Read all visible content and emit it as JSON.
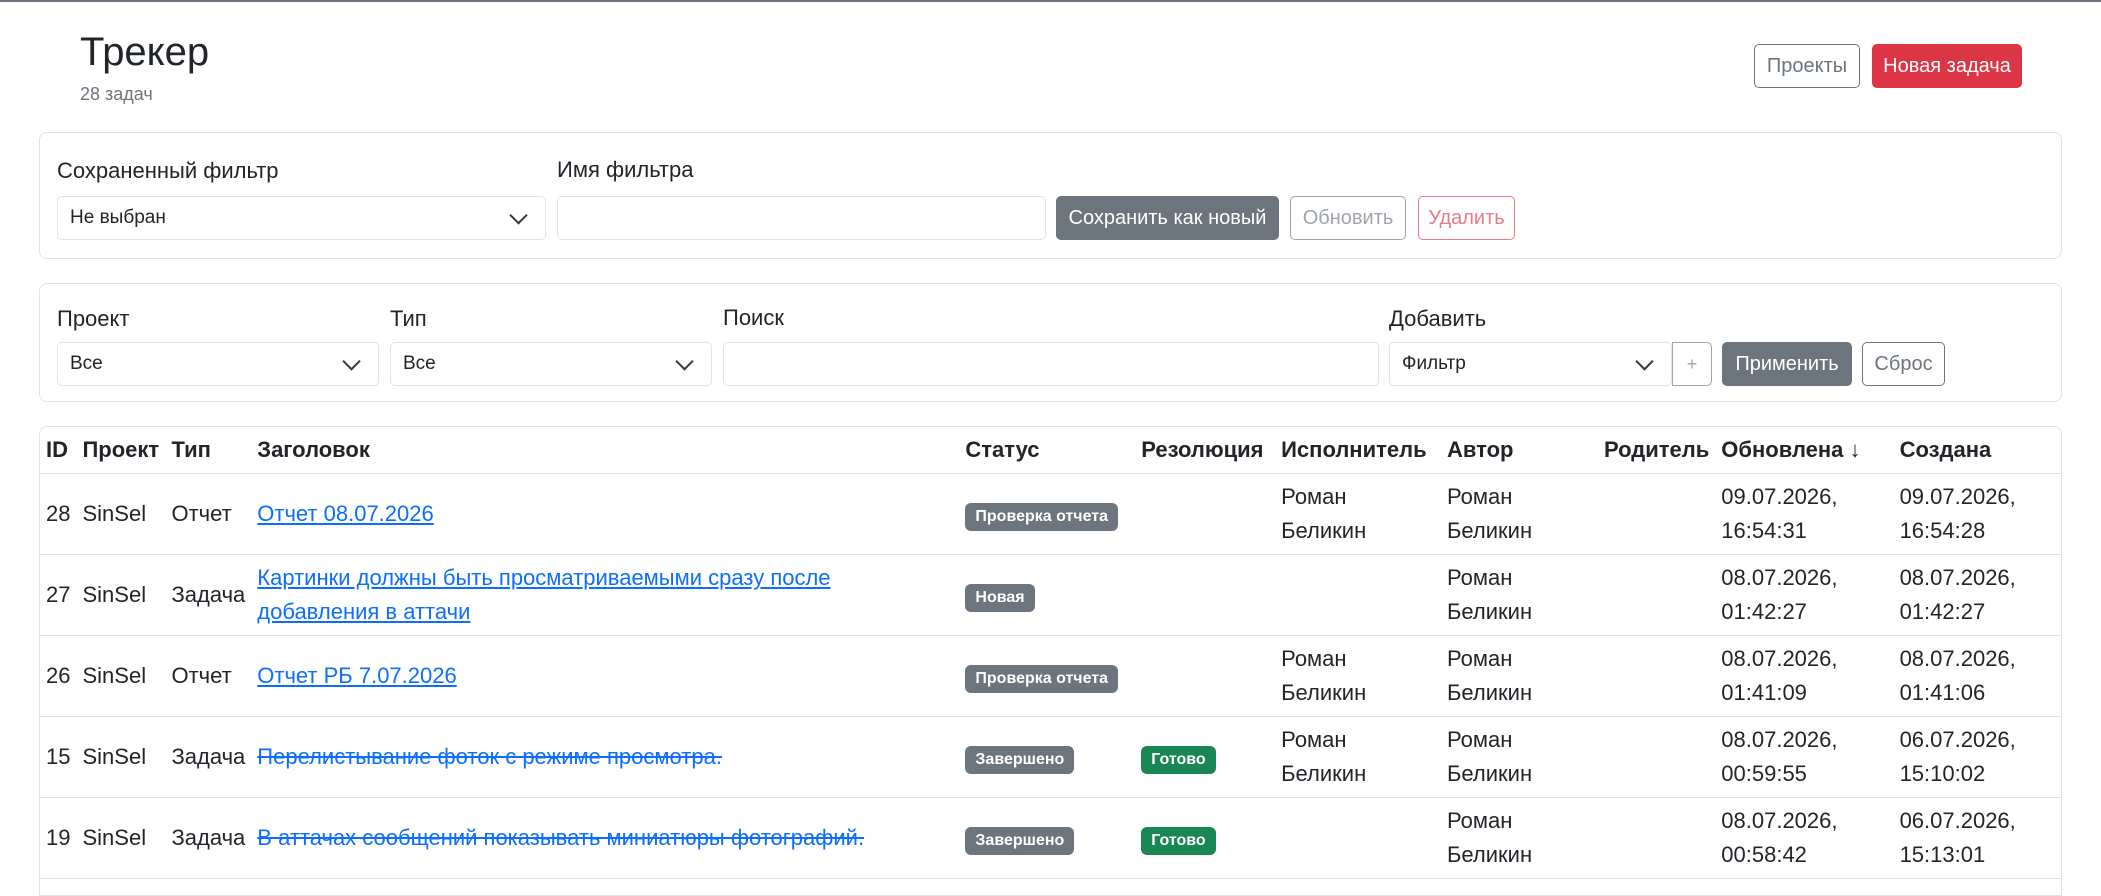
{
  "header": {
    "title": "Трекер",
    "count": "28 задач",
    "projects_button": "Проекты",
    "new_task_button": "Новая задача"
  },
  "saved_filter": {
    "label": "Сохраненный фильтр",
    "selected": "Не выбран",
    "name_label": "Имя фильтра",
    "name_value": "",
    "save_new_button": "Сохранить как новый",
    "update_button": "Обновить",
    "delete_button": "Удалить"
  },
  "filters": {
    "project_label": "Проект",
    "project_selected": "Все",
    "type_label": "Тип",
    "type_selected": "Все",
    "search_label": "Поиск",
    "search_value": "",
    "add_label": "Добавить",
    "add_selected": "Фильтр",
    "plus_button": "+",
    "apply_button": "Применить",
    "reset_button": "Сброс"
  },
  "table": {
    "columns": {
      "id": "ID",
      "project": "Проект",
      "type": "Тип",
      "title": "Заголовок",
      "status": "Статус",
      "resolution": "Резолюция",
      "assignee": "Исполнитель",
      "author": "Автор",
      "parent": "Родитель",
      "updated": "Обновлена ↓",
      "created": "Создана"
    },
    "rows": [
      {
        "id": "28",
        "project": "SinSel",
        "type": "Отчет",
        "title": "Отчет 08.07.2026",
        "status": "Проверка отчета",
        "resolution": "",
        "assignee_1": "Роман",
        "assignee_2": "Беликин",
        "author_1": "Роман",
        "author_2": "Беликин",
        "parent": "",
        "updated_1": "09.07.2026,",
        "updated_2": "16:54:31",
        "created_1": "09.07.2026,",
        "created_2": "16:54:28"
      },
      {
        "id": "27",
        "project": "SinSel",
        "type": "Задача",
        "title": "Картинки должны быть просматриваемыми сразу после добавления в аттачи",
        "status": "Новая",
        "resolution": "",
        "assignee_1": "",
        "assignee_2": "",
        "author_1": "Роман",
        "author_2": "Беликин",
        "parent": "",
        "updated_1": "08.07.2026,",
        "updated_2": "01:42:27",
        "created_1": "08.07.2026,",
        "created_2": "01:42:27"
      },
      {
        "id": "26",
        "project": "SinSel",
        "type": "Отчет",
        "title": "Отчет РБ 7.07.2026",
        "status": "Проверка отчета",
        "resolution": "",
        "assignee_1": "Роман",
        "assignee_2": "Беликин",
        "author_1": "Роман",
        "author_2": "Беликин",
        "parent": "",
        "updated_1": "08.07.2026,",
        "updated_2": "01:41:09",
        "created_1": "08.07.2026,",
        "created_2": "01:41:06"
      },
      {
        "id": "15",
        "project": "SinSel",
        "type": "Задача",
        "title": "Перелистывание фоток с режиме просмотра.",
        "status": "Завершено",
        "resolution": "Готово",
        "assignee_1": "Роман",
        "assignee_2": "Беликин",
        "author_1": "Роман",
        "author_2": "Беликин",
        "parent": "",
        "updated_1": "08.07.2026,",
        "updated_2": "00:59:55",
        "created_1": "06.07.2026,",
        "created_2": "15:10:02"
      },
      {
        "id": "19",
        "project": "SinSel",
        "type": "Задача",
        "title": "В аттачах сообщений показывать миниатюры фотографий.",
        "status": "Завершено",
        "resolution": "Готово",
        "assignee_1": "",
        "assignee_2": "",
        "author_1": "Роман",
        "author_2": "Беликин",
        "parent": "",
        "updated_1": "08.07.2026,",
        "updated_2": "00:58:42",
        "created_1": "06.07.2026,",
        "created_2": "15:13:01"
      }
    ]
  },
  "colors": {
    "primary_link": "#0d6efd",
    "danger": "#dc3545",
    "secondary": "#6c757d",
    "success": "#198754"
  }
}
